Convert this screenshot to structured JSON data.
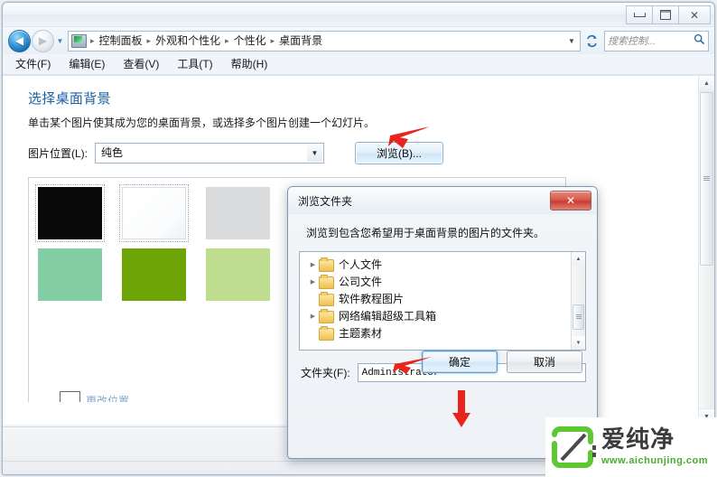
{
  "window": {
    "titlebar_buttons": [
      {
        "name": "minimize",
        "glyph": "—"
      },
      {
        "name": "maximize",
        "glyph": "□"
      },
      {
        "name": "close",
        "glyph": "✕"
      }
    ]
  },
  "navbar": {
    "back_glyph": "◀",
    "forward_glyph": "▶",
    "history_caret": "▼",
    "address_caret": "▼",
    "breadcrumbs": [
      "控制面板",
      "外观和个性化",
      "个性化",
      "桌面背景"
    ],
    "breadcrumb_separator": "▸",
    "refresh_name": "refresh-icon",
    "search": {
      "placeholder": "搜索控制...",
      "icon": "🔍"
    }
  },
  "menubar": {
    "items": [
      "文件(F)",
      "编辑(E)",
      "查看(V)",
      "工具(T)",
      "帮助(H)"
    ]
  },
  "main": {
    "heading": "选择桌面背景",
    "description": "单击某个图片使其成为您的桌面背景，或选择多个图片创建一个幻灯片。",
    "picture_location_label": "图片位置(L):",
    "picture_location_value": "纯色",
    "combo_caret": "▼",
    "browse_button": "浏览(B)...",
    "swatches": [
      {
        "name": "black",
        "color": "#0a0a0a",
        "selected": true
      },
      {
        "name": "white",
        "color": "#ffffff",
        "selected": true
      },
      {
        "name": "light-gray",
        "color": "#d9dbdd",
        "selected": false
      },
      {
        "name": "steel-blue",
        "color": "#3d92ce",
        "selected": false
      },
      {
        "name": "sky-blue",
        "color": "#9ddcee",
        "selected": false
      },
      {
        "name": "teal-blue",
        "color": "#0b79a8",
        "selected": false
      },
      {
        "name": "mint-green",
        "color": "#82cda4",
        "selected": false
      },
      {
        "name": "olive-green",
        "color": "#6fa406",
        "selected": false
      },
      {
        "name": "pale-green",
        "color": "#bedd8e",
        "selected": false
      }
    ],
    "bottom_link": "更改位置"
  },
  "scrollbars": {
    "up_glyph": "▲",
    "down_glyph": "▼"
  },
  "dialog": {
    "title": "浏览文件夹",
    "close_glyph": "✕",
    "prompt": "浏览到包含您希望用于桌面背景的图片的文件夹。",
    "tree_items": [
      {
        "label": "个人文件",
        "expandable": true
      },
      {
        "label": "公司文件",
        "expandable": true
      },
      {
        "label": "软件教程图片",
        "expandable": false
      },
      {
        "label": "网络编辑超级工具箱",
        "expandable": true
      },
      {
        "label": "主题素材",
        "expandable": false
      }
    ],
    "twisty_glyph": "▶",
    "folder_label": "文件夹(F):",
    "folder_value": "Administrator",
    "ok_button": "确定",
    "cancel_button": "取消"
  },
  "annotations": {
    "arrow_browse": "red-arrow-pointing-to-browse-button",
    "arrow_folder": "red-arrow-pointing-to-theme-folder",
    "arrow_ok": "red-arrow-pointing-to-ok-button"
  },
  "watermark": {
    "brand": "爱纯净",
    "url": "www.aichunjing.com",
    "accent": "#4aab2e"
  }
}
